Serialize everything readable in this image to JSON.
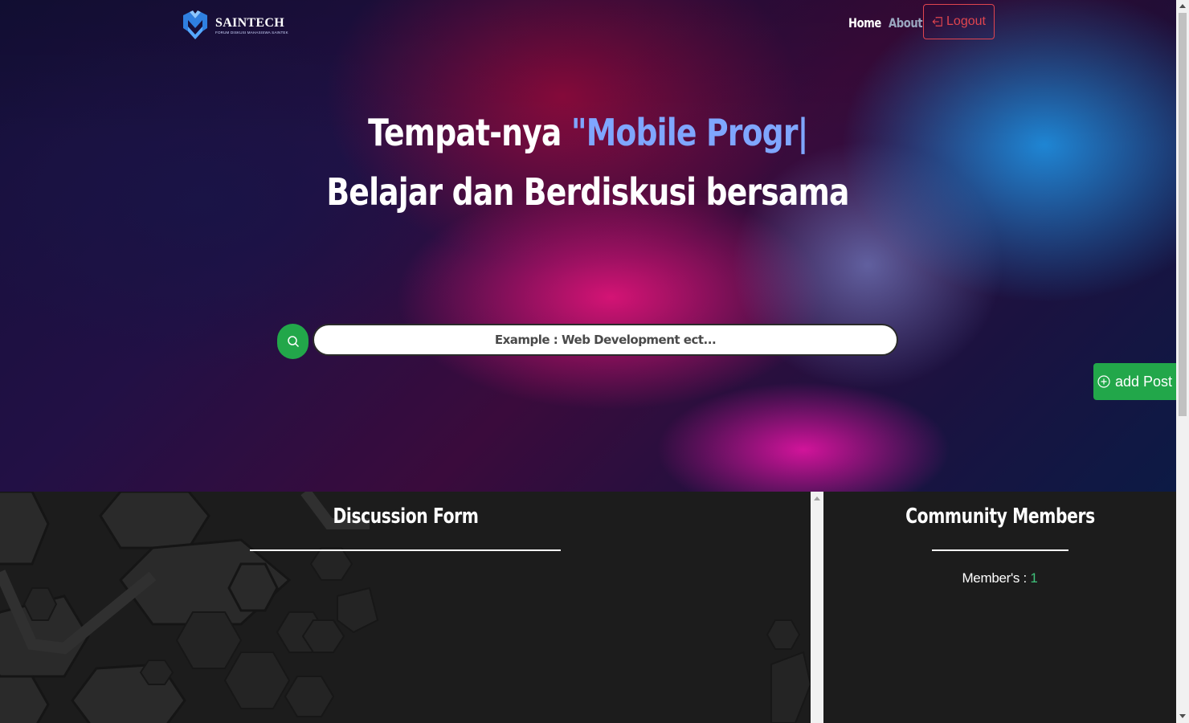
{
  "brand": {
    "title": "SAINTECH",
    "subtitle": "FORUM DISKUSI MAHASISWA SAINTEK",
    "logo_icon": "saintech-logo-icon"
  },
  "nav": {
    "home": "Home",
    "about": "About",
    "logout": "Logout",
    "logout_icon": "box-arrow-left-icon"
  },
  "hero": {
    "line1_prefix": "Tempat-nya ",
    "line1_typed": "\"Mobile Progr|",
    "line2": "Belajar dan Berdiskusi bersama"
  },
  "search": {
    "placeholder": "Example : Web Development ect...",
    "icon": "search-icon"
  },
  "add_post": {
    "label": "add Post",
    "icon": "plus-circle-icon"
  },
  "discussion": {
    "title": "Discussion Form"
  },
  "community": {
    "title": "Community Members",
    "members_label": "Member's : ",
    "members_count": "1"
  },
  "colors": {
    "accent_green": "#22a74a",
    "logout_red": "#e0454f",
    "headline_accent": "#7fa6ff",
    "member_count": "#3fc27a"
  }
}
